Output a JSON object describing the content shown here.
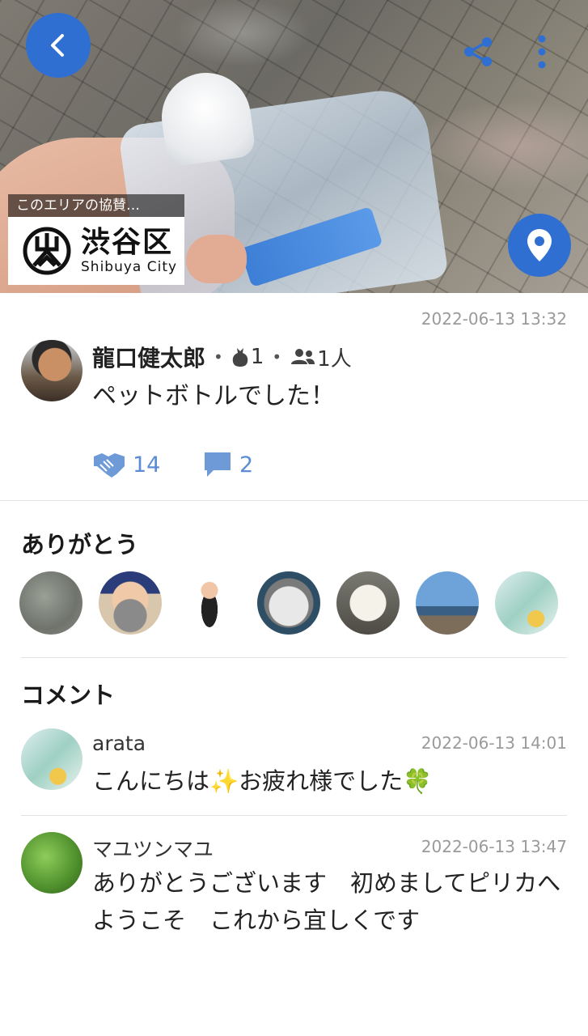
{
  "sponsor": {
    "caption": "このエリアの協賛…",
    "name": "渋谷区",
    "sub": "Shibuya City"
  },
  "post": {
    "date": "2022-06-13 13:32",
    "author": "龍口健太郎",
    "pick_count": "1",
    "people_count": "1人",
    "text": "ペットボトルでした！",
    "thanks_count": "14",
    "comment_count": "2"
  },
  "sections": {
    "thanks_title": "ありがとう",
    "comments_title": "コメント"
  },
  "thanks_avatars": [
    "avatar-1",
    "avatar-2",
    "avatar-3",
    "avatar-4",
    "avatar-5",
    "avatar-6",
    "avatar-7"
  ],
  "comments": [
    {
      "name": "arata",
      "date": "2022-06-13 14:01",
      "text": "こんにちは✨お疲れ様でした🍀"
    },
    {
      "name": "マユツンマユ",
      "date": "2022-06-13 13:47",
      "text": "ありがとうございます　初めましてピリカへようこそ　これから宜しくです"
    }
  ],
  "colors": {
    "accent": "#2f6fd1",
    "action": "#5b8cd4",
    "meta_text": "#9a9a9a"
  },
  "icons": [
    "back-icon",
    "share-icon",
    "more-icon",
    "map-pin-icon",
    "trash-bag-icon",
    "people-icon",
    "handshake-icon",
    "comment-icon"
  ]
}
